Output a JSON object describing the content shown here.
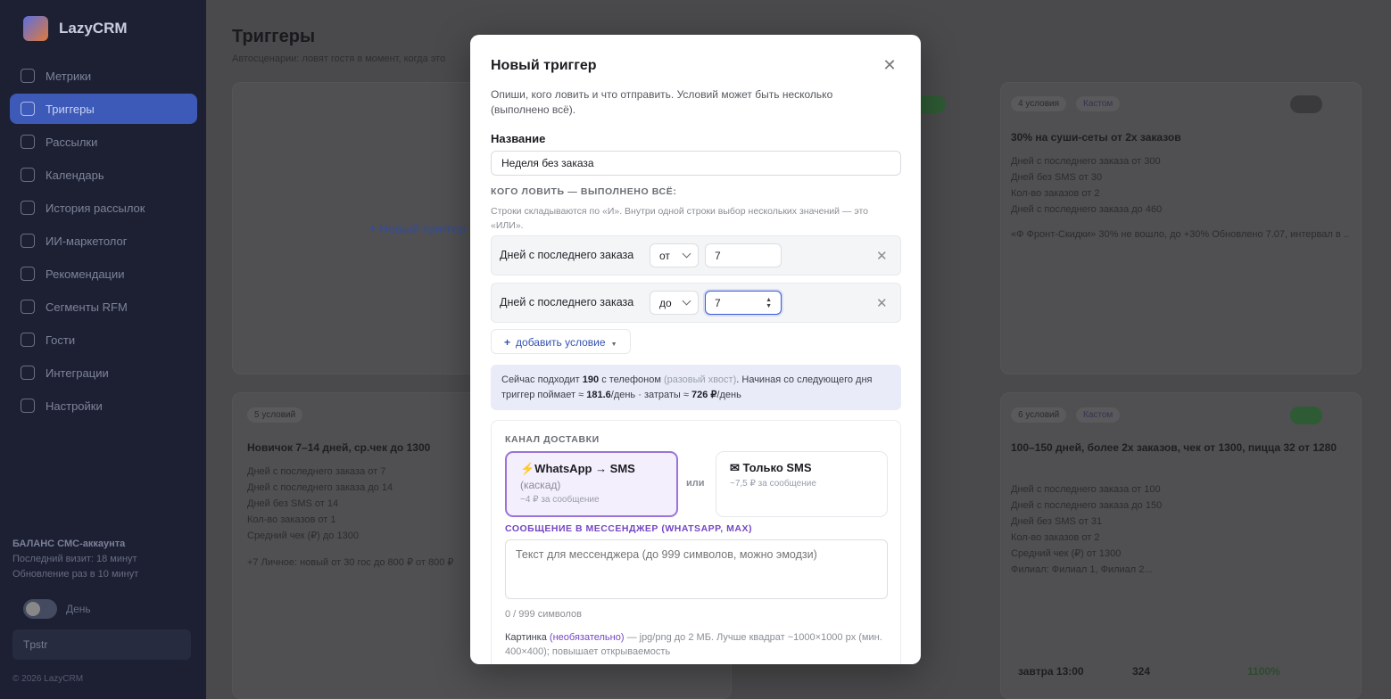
{
  "app": {
    "name": "LazyCRM"
  },
  "sidebar": {
    "items": [
      {
        "label": "Метрики",
        "active": false
      },
      {
        "label": "Триггеры",
        "active": true
      },
      {
        "label": "Рассылки",
        "active": false
      },
      {
        "label": "Календарь",
        "active": false
      },
      {
        "label": "История рассылок",
        "active": false
      },
      {
        "label": "ИИ-маркетолог",
        "active": false
      },
      {
        "label": "Рекомендации",
        "active": false
      },
      {
        "label": "Сегменты RFM",
        "active": false
      },
      {
        "label": "Гости",
        "active": false
      },
      {
        "label": "Интеграции",
        "active": false
      },
      {
        "label": "Настройки",
        "active": false
      }
    ],
    "balance_title": "БАЛАНС СМС-аккаунта",
    "balance_line1": "Последний визит: 18 минут",
    "balance_line2": "Обновление раз в 10 минут",
    "theme_label": "День",
    "account_select": "Tpstr",
    "footer": "© 2026 LazyCRM"
  },
  "page": {
    "title": "Триггеры",
    "subtitle": "Автосценарии: ловят гостя в момент, когда это",
    "new_trigger_link": "+ Новый триггер"
  },
  "bg_cards": {
    "card_a": {
      "chip": "4 условия",
      "badge": "Кастом",
      "title": "30% на суши-сеты от 2х заказов",
      "lines": [
        "Дней с последнего заказа от 300",
        "Дней без SMS от 30",
        "Кол-во заказов от 2",
        "Дней с последнего заказа до 460"
      ],
      "footnote": "«Ф Фронт-Скидки» 30% не вошло, до +30% Обновлено 7.07, интервал в ..."
    },
    "card_b": {
      "chip": "5 условий",
      "title": "Новичок 7–14 дней, ср.чек до 1300",
      "lines": [
        "Дней с последнего заказа от 7",
        "Дней с последнего заказа до 14",
        "Дней без SMS от 14",
        "Кол-во заказов от 1",
        "Средний чек (₽) до 1300"
      ],
      "footnote": "+7 Личное: новый от 30 гос до 800 ₽ от 800 ₽"
    },
    "card_c": {
      "chip": "6 условий",
      "badge": "Кастом",
      "title": "100–150 дней, более 2х заказов, чек от 1300, пицца 32 от 1280",
      "lines": [
        "Дней с последнего заказа от 100",
        "Дней с последнего заказа до 150",
        "Дней без SMS от 31",
        "Кол-во заказов от 2",
        "Средний чек (₽) от 1300",
        "Филиал: Филиал 1, Филиал 2..."
      ],
      "stats": [
        "завтра 13:00",
        "324",
        "1100%"
      ]
    }
  },
  "modal": {
    "title": "Новый триггер",
    "close_icon": "close-icon",
    "description": "Опиши, кого ловить и что отправить. Условий может быть несколько (выполнено всё).",
    "name_label": "Название",
    "name_value": "Неделя без заказа",
    "who_caption": "КОГО ЛОВИТЬ — ВЫПОЛНЕНО ВСЁ:",
    "who_hint": "Строки складываются по «И». Внутри одной строки выбор нескольких значений — это «ИЛИ».",
    "conditions": [
      {
        "field": "Дней с последнего заказа",
        "op": "от",
        "value": "7"
      },
      {
        "field": "Дней с последнего заказа",
        "op": "до",
        "value": "7"
      }
    ],
    "add_condition": "добавить условие",
    "info": {
      "p1": "Сейчас подходит",
      "count": "190",
      "p2": "с телефоном",
      "muted": "(разовый хвост)",
      "p3": ". Начиная со следующего дня триггер поймает ≈",
      "per_day": "181.6",
      "p4": "/день · затраты ≈",
      "cost": "726 ₽",
      "p5": "/день"
    },
    "delivery": {
      "caption": "КАНАЛ ДОСТАВКИ",
      "options": [
        {
          "title": "⚡WhatsApp → SMS",
          "sub": "(каскад)",
          "price": "~4 ₽ за сообщение",
          "selected": true
        },
        {
          "title": "✉ Только SMS",
          "sub": "",
          "price": "~7,5 ₽ за сообщение",
          "selected": false
        }
      ],
      "or_label": "или",
      "message_caption": "СООБЩЕНИЕ В МЕССЕНДЖЕР (WHATSAPP, MAX)",
      "message_placeholder": "Текст для мессенджера (до 999 символов, можно эмодзи)",
      "counter": "0 / 999 символов",
      "picture_label": "Картинка",
      "picture_optional": "(необязательно)",
      "picture_note": "— jpg/png до 2 МБ. Лучше квадрат ~1000×1000 px (мин. 400×400); повышает открываемость"
    }
  },
  "colors": {
    "accent": "#3b5bdb",
    "purple": "#7446c4",
    "sidebar_bg": "#1d2033"
  }
}
